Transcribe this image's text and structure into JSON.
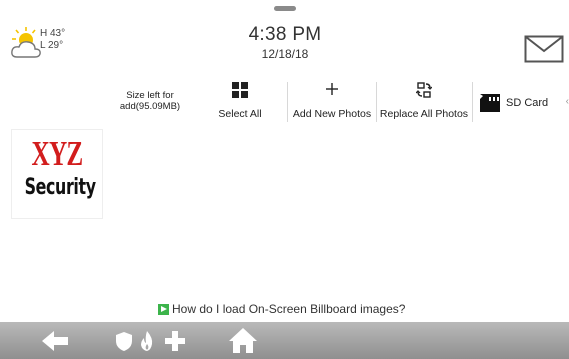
{
  "weather": {
    "icon": "partly-cloudy-icon",
    "high": "H 43°",
    "low": "L 29°"
  },
  "clock": {
    "time": "4:38 PM",
    "date": "12/18/18"
  },
  "header": {
    "mail_icon": "mail-icon",
    "handle_icon": "pull-handle"
  },
  "toolbar": {
    "size_left_line1": "Size left for",
    "size_left_line2": "add(95.09MB)",
    "select_all": "Select All",
    "add_new_photos": "Add New Photos",
    "replace_all_photos": "Replace All Photos",
    "sd_card": "SD Card"
  },
  "photos": [
    {
      "line1": "XYZ",
      "line2": "Security"
    }
  ],
  "help": {
    "text": "How do I load On-Screen Billboard images?"
  },
  "bottom_nav": {
    "items": [
      "back-arrow-icon",
      "shield-icon",
      "fire-icon",
      "medical-plus-icon",
      "home-icon"
    ]
  },
  "colors": {
    "brand_red": "#d21d1d",
    "help_icon_green": "#3cb44b",
    "bottom_bar": "#a5a5a5"
  }
}
